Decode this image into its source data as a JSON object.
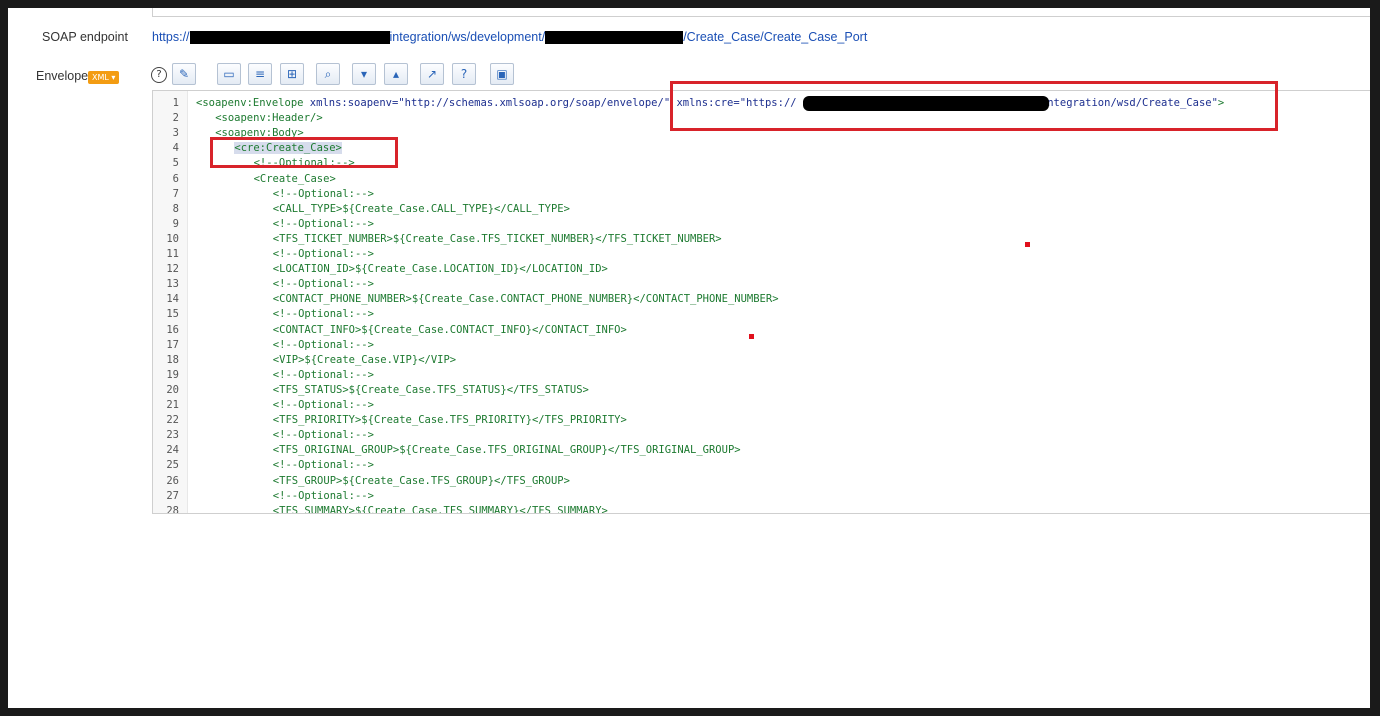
{
  "labels": {
    "soap_endpoint": "SOAP endpoint",
    "envelope": "Envelope",
    "xml_badge": "XML"
  },
  "endpoint": {
    "prefix": "https://",
    "middle": "integration/ws/development/",
    "suffix": "/Create_Case/Create_Case_Port"
  },
  "toolbar": {
    "help_glyph": "?",
    "buttons": [
      {
        "name": "wizard-icon",
        "glyph": "✎"
      },
      {
        "name": "comment-icon",
        "glyph": "▭"
      },
      {
        "name": "format-icon",
        "glyph": "≡"
      },
      {
        "name": "tree-icon",
        "glyph": "⊞"
      },
      {
        "name": "search-icon",
        "glyph": "⌕"
      },
      {
        "name": "expand-icon",
        "glyph": "▾"
      },
      {
        "name": "collapse-icon",
        "glyph": "▴"
      },
      {
        "name": "external-icon",
        "glyph": "↗"
      },
      {
        "name": "help-circle-icon",
        "glyph": "?"
      },
      {
        "name": "save-icon",
        "glyph": "▣"
      }
    ]
  },
  "editor": {
    "line_numbers": [
      "1",
      "2",
      "3",
      "4",
      "5",
      "6",
      "7",
      "8",
      "9",
      "10",
      "11",
      "12",
      "13",
      "14",
      "15",
      "16",
      "17",
      "18",
      "19",
      "20",
      "21",
      "22",
      "23",
      "24",
      "25",
      "26",
      "27",
      "28"
    ],
    "line1": {
      "open": "<soapenv:Envelope ",
      "attr1": "xmlns:soapenv=",
      "val1": "\"http://schemas.xmlsoap.org/soap/envelope/\"",
      "attr2": " xmlns:cre=",
      "val2a": "\"https://",
      "val2b": "/integration/wsd/Create_Case\"",
      "close": ">"
    },
    "lines": [
      {
        "indent": 2,
        "text": "<soapenv:Header/>"
      },
      {
        "indent": 2,
        "text": "<soapenv:Body>"
      },
      {
        "indent": 4,
        "text": "<cre:Create_Case>"
      },
      {
        "indent": 6,
        "text": "<!--Optional:-->"
      },
      {
        "indent": 6,
        "text": "<Create_Case>"
      },
      {
        "indent": 8,
        "text": "<!--Optional:-->"
      },
      {
        "indent": 8,
        "text": "<CALL_TYPE>${Create_Case.CALL_TYPE}</CALL_TYPE>"
      },
      {
        "indent": 8,
        "text": "<!--Optional:-->"
      },
      {
        "indent": 8,
        "text": "<TFS_TICKET_NUMBER>${Create_Case.TFS_TICKET_NUMBER}</TFS_TICKET_NUMBER>"
      },
      {
        "indent": 8,
        "text": "<!--Optional:-->"
      },
      {
        "indent": 8,
        "text": "<LOCATION_ID>${Create_Case.LOCATION_ID}</LOCATION_ID>"
      },
      {
        "indent": 8,
        "text": "<!--Optional:-->"
      },
      {
        "indent": 8,
        "text": "<CONTACT_PHONE_NUMBER>${Create_Case.CONTACT_PHONE_NUMBER}</CONTACT_PHONE_NUMBER>"
      },
      {
        "indent": 8,
        "text": "<!--Optional:-->"
      },
      {
        "indent": 8,
        "text": "<CONTACT_INFO>${Create_Case.CONTACT_INFO}</CONTACT_INFO>"
      },
      {
        "indent": 8,
        "text": "<!--Optional:-->"
      },
      {
        "indent": 8,
        "text": "<VIP>${Create_Case.VIP}</VIP>"
      },
      {
        "indent": 8,
        "text": "<!--Optional:-->"
      },
      {
        "indent": 8,
        "text": "<TFS_STATUS>${Create_Case.TFS_STATUS}</TFS_STATUS>"
      },
      {
        "indent": 8,
        "text": "<!--Optional:-->"
      },
      {
        "indent": 8,
        "text": "<TFS_PRIORITY>${Create_Case.TFS_PRIORITY}</TFS_PRIORITY>"
      },
      {
        "indent": 8,
        "text": "<!--Optional:-->"
      },
      {
        "indent": 8,
        "text": "<TFS_ORIGINAL_GROUP>${Create_Case.TFS_ORIGINAL_GROUP}</TFS_ORIGINAL_GROUP>"
      },
      {
        "indent": 8,
        "text": "<!--Optional:-->"
      },
      {
        "indent": 8,
        "text": "<TFS_GROUP>${Create_Case.TFS_GROUP}</TFS_GROUP>"
      },
      {
        "indent": 8,
        "text": "<!--Optional:-->"
      },
      {
        "indent": 8,
        "text": "<TFS_SUMMARY>${Create_Case.TFS_SUMMARY}</TFS_SUMMARY>"
      }
    ]
  },
  "colors": {
    "annotation_red": "#d8232a",
    "link_blue": "#1a4fb5",
    "tag_green": "#1d7a30",
    "attr_navy": "#1d2f8f"
  }
}
